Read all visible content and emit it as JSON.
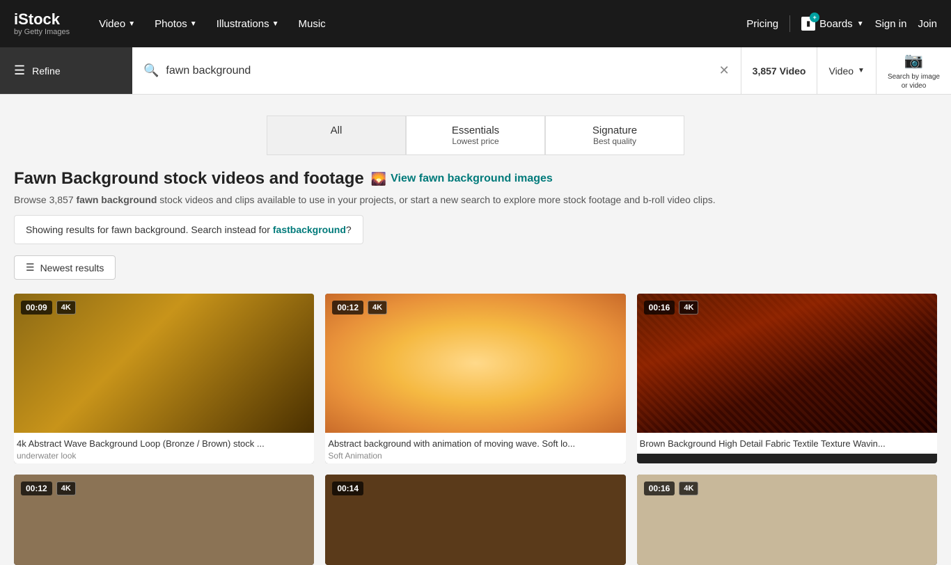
{
  "header": {
    "logo_main": "iStock",
    "logo_sub": "by Getty Images",
    "nav_items": [
      {
        "label": "Video",
        "has_dropdown": true
      },
      {
        "label": "Photos",
        "has_dropdown": true
      },
      {
        "label": "Illustrations",
        "has_dropdown": true
      },
      {
        "label": "Music",
        "has_dropdown": false
      }
    ],
    "pricing_label": "Pricing",
    "boards_label": "Boards",
    "boards_badge": "+",
    "sign_in_label": "Sign in",
    "join_label": "Join",
    "search_by_image_label": "Search by image\nor video"
  },
  "search_bar": {
    "refine_label": "Refine",
    "search_query": "fawn background",
    "results_count": "3,857",
    "filter_label": "Video"
  },
  "tabs": [
    {
      "label": "All",
      "sublabel": "",
      "active": true
    },
    {
      "label": "Essentials",
      "sublabel": "Lowest price",
      "active": false
    },
    {
      "label": "Signature",
      "sublabel": "Best quality",
      "active": false
    }
  ],
  "page": {
    "title": "Fawn Background stock videos and footage",
    "view_images_link": "View fawn background images",
    "description_prefix": "Browse 3,857 ",
    "description_bold": "fawn background",
    "description_suffix": " stock videos and clips available to use in your projects, or start a new search to explore more stock footage and b-roll video clips.",
    "correction_prefix": "Showing results for fawn background. Search instead for ",
    "correction_link": "fastbackground",
    "correction_suffix": "?",
    "sort_label": "Newest results"
  },
  "videos": [
    {
      "id": 1,
      "time": "00:09",
      "quality": "4K",
      "title": "4k Abstract Wave Background Loop (Bronze / Brown) stock ...",
      "author": "underwater look",
      "thumb_class": "thumb-bronze"
    },
    {
      "id": 2,
      "time": "00:12",
      "quality": "4K",
      "title": "Abstract background with animation of moving wave. Soft lo...",
      "author": "Soft Animation",
      "thumb_class": "thumb-warm"
    },
    {
      "id": 3,
      "time": "00:16",
      "quality": "4K",
      "title": "Brown Background High Detail Fabric Textile Texture Wavin...",
      "author": "",
      "thumb_class": "thumb-dark-fabric"
    },
    {
      "id": 4,
      "time": "00:12",
      "quality": "4K",
      "title": "",
      "author": "",
      "thumb_class": "thumb-placeholder"
    },
    {
      "id": 5,
      "time": "00:14",
      "quality": "",
      "title": "",
      "author": "",
      "thumb_class": "thumb-placeholder2"
    },
    {
      "id": 6,
      "time": "00:16",
      "quality": "4K",
      "title": "",
      "author": "",
      "thumb_class": "thumb-placeholder3"
    }
  ]
}
